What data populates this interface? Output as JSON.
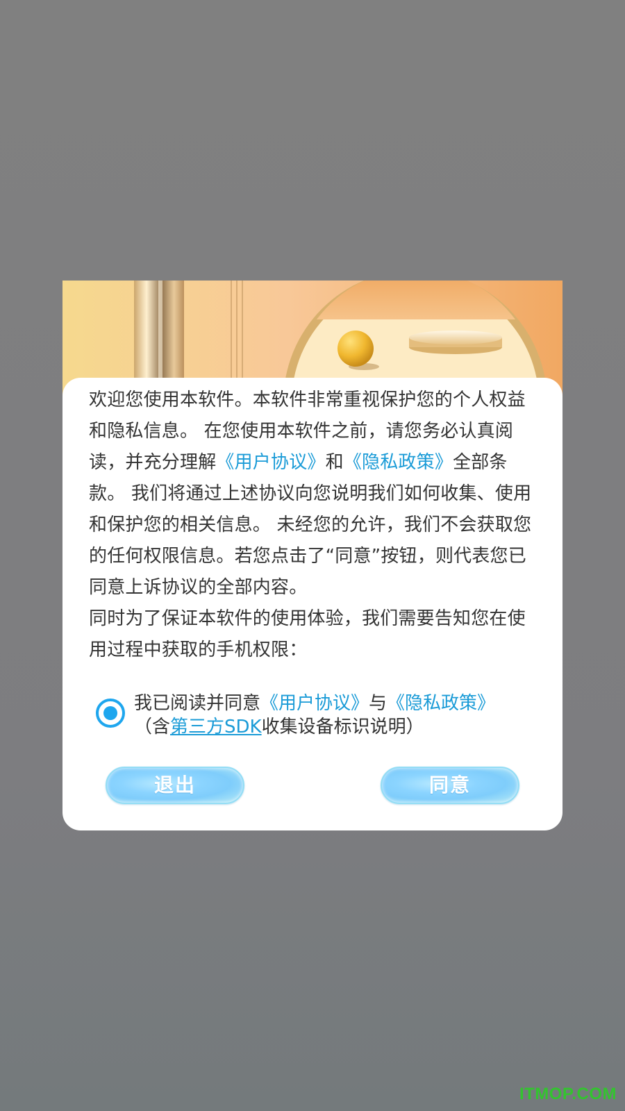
{
  "dialog": {
    "paragraph": {
      "part1": "欢迎您使用本软件。本软件非常重视保护您的个人权益和隐私信息。 在您使用本软件之前，请您务必认真阅读，并充分理解",
      "user_agreement_link": "《用户协议》",
      "and": "和",
      "privacy_policy_link": "《隐私政策》",
      "part2": "全部条款。 我们将通过上述协议向您说明我们如何收集、使用和保护您的相关信息。 未经您的允许，我们不会获取您的任何权限信息。若您点击了“同意”按钮，则代表您已同意上诉协议的全部内容。",
      "part3": " 同时为了保证本软件的使用体验，我们需要告知您在使用过程中获取的手机权限："
    },
    "consent": {
      "checked": true,
      "prefix": "我已阅读并同意",
      "user_agreement_link": "《用户协议》",
      "with": "与",
      "privacy_policy_link": "《隐私政策》",
      "paren_open": "（含",
      "sdk_link": "第三方SDK",
      "suffix": "收集设备标识说明）"
    },
    "buttons": {
      "exit_label": "退出",
      "agree_label": "同意"
    },
    "accent_color": "#1ea6ee"
  },
  "watermark": "ITMOP.COM"
}
